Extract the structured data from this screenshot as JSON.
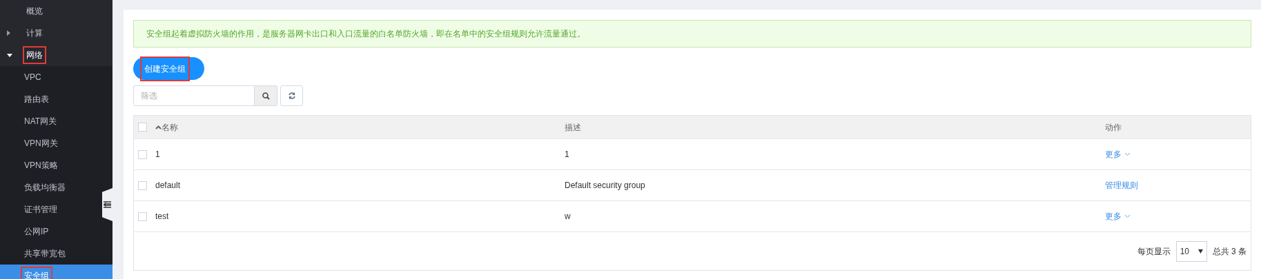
{
  "sidebar": {
    "items": [
      {
        "label": "概览",
        "selected": false,
        "highlighted": false
      },
      {
        "label": "计算",
        "expanded": false,
        "highlighted": false
      },
      {
        "label": "网络",
        "expanded": true,
        "highlighted": true,
        "children": [
          {
            "label": "VPC",
            "selected": false,
            "highlighted": false
          },
          {
            "label": "路由表",
            "selected": false,
            "highlighted": false
          },
          {
            "label": "NAT网关",
            "selected": false,
            "highlighted": false
          },
          {
            "label": "VPN网关",
            "selected": false,
            "highlighted": false
          },
          {
            "label": "VPN策略",
            "selected": false,
            "highlighted": false
          },
          {
            "label": "负载均衡器",
            "selected": false,
            "highlighted": false
          },
          {
            "label": "证书管理",
            "selected": false,
            "highlighted": false
          },
          {
            "label": "公网IP",
            "selected": false,
            "highlighted": false
          },
          {
            "label": "共享带宽包",
            "selected": false,
            "highlighted": false
          },
          {
            "label": "安全组",
            "selected": true,
            "highlighted": true
          }
        ]
      }
    ]
  },
  "alert": "安全组起着虚拟防火墙的作用，是服务器网卡出口和入口流量的白名单防火墙，即在名单中的安全组规则允许流量通过。",
  "create_button": {
    "label": "创建安全组",
    "highlighted": true
  },
  "filter": {
    "placeholder": "筛选"
  },
  "table": {
    "columns": [
      "名称",
      "描述",
      "动作"
    ],
    "select_all": false,
    "rows": [
      {
        "checked": false,
        "name": "1",
        "description": "1",
        "action": {
          "kind": "menu",
          "label": "更多"
        }
      },
      {
        "checked": false,
        "name": "default",
        "description": "Default security group",
        "action": {
          "kind": "link",
          "label": "管理规则"
        }
      },
      {
        "checked": false,
        "name": "test",
        "description": "w",
        "action": {
          "kind": "menu",
          "label": "更多"
        }
      }
    ]
  },
  "pagination": {
    "per_page_label": "每页显示",
    "page_size": "10",
    "total": "总共 3 条"
  }
}
